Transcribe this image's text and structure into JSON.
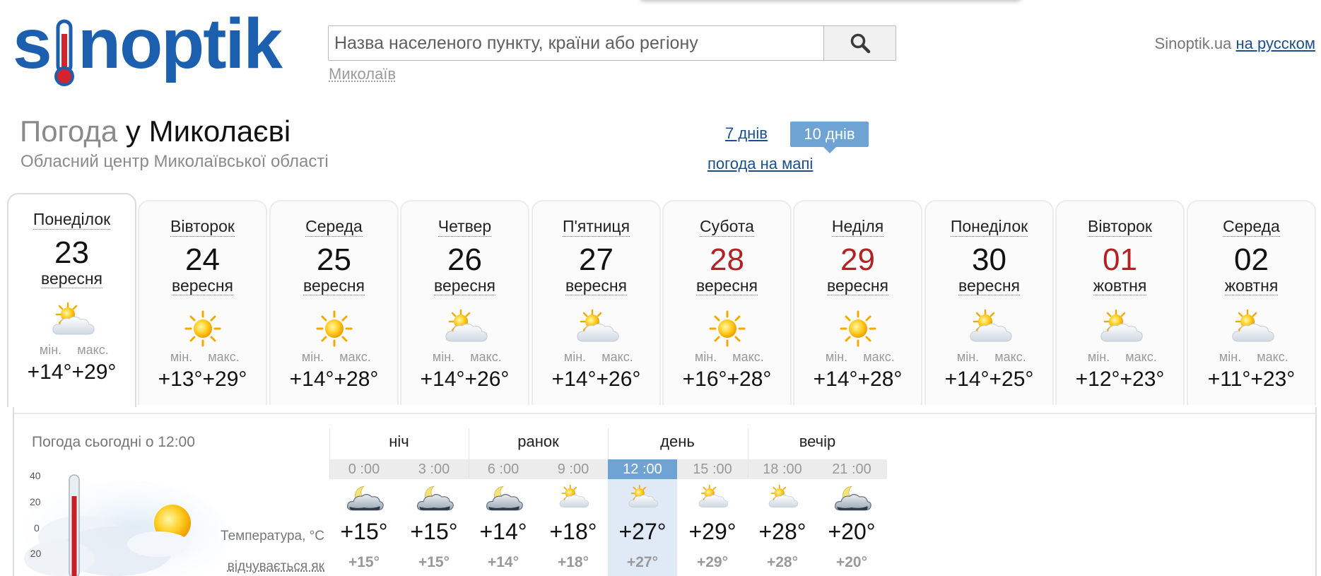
{
  "header": {
    "search_placeholder": "Назва населеного пункту, країни або регіону",
    "recent_city": "Миколаїв",
    "site_name": "Sinoptik.ua",
    "lang_link": "на русском"
  },
  "page": {
    "title_prefix": "Погода",
    "title_city": "у Миколаєві",
    "subtitle": "Обласний центр Миколаївської області",
    "days7": "7 днів",
    "days10": "10 днів",
    "map_link": "погода на мапі"
  },
  "days": [
    {
      "name": "Понеділок",
      "num": "23",
      "month": "вересня",
      "min_label": "мін.",
      "max_label": "макс.",
      "min": "+14°",
      "max": "+29°",
      "icon": "sun-cloud-icon",
      "weekend": false,
      "active": true
    },
    {
      "name": "Вівторок",
      "num": "24",
      "month": "вересня",
      "min_label": "мін.",
      "max_label": "макс.",
      "min": "+13°",
      "max": "+29°",
      "icon": "sun-icon",
      "weekend": false,
      "active": false
    },
    {
      "name": "Середа",
      "num": "25",
      "month": "вересня",
      "min_label": "мін.",
      "max_label": "макс.",
      "min": "+14°",
      "max": "+28°",
      "icon": "sun-icon",
      "weekend": false,
      "active": false
    },
    {
      "name": "Четвер",
      "num": "26",
      "month": "вересня",
      "min_label": "мін.",
      "max_label": "макс.",
      "min": "+14°",
      "max": "+26°",
      "icon": "sun-cloud-icon",
      "weekend": false,
      "active": false
    },
    {
      "name": "П'ятниця",
      "num": "27",
      "month": "вересня",
      "min_label": "мін.",
      "max_label": "макс.",
      "min": "+14°",
      "max": "+26°",
      "icon": "sun-cloud-icon",
      "weekend": false,
      "active": false
    },
    {
      "name": "Субота",
      "num": "28",
      "month": "вересня",
      "min_label": "мін.",
      "max_label": "макс.",
      "min": "+16°",
      "max": "+28°",
      "icon": "sun-icon",
      "weekend": true,
      "active": false
    },
    {
      "name": "Неділя",
      "num": "29",
      "month": "вересня",
      "min_label": "мін.",
      "max_label": "макс.",
      "min": "+14°",
      "max": "+28°",
      "icon": "sun-icon",
      "weekend": true,
      "active": false
    },
    {
      "name": "Понеділок",
      "num": "30",
      "month": "вересня",
      "min_label": "мін.",
      "max_label": "макс.",
      "min": "+14°",
      "max": "+25°",
      "icon": "sun-cloud-icon",
      "weekend": false,
      "active": false
    },
    {
      "name": "Вівторок",
      "num": "01",
      "month": "жовтня",
      "min_label": "мін.",
      "max_label": "макс.",
      "min": "+12°",
      "max": "+23°",
      "icon": "sun-cloud-icon",
      "weekend": true,
      "active": false
    },
    {
      "name": "Середа",
      "num": "02",
      "month": "жовтня",
      "min_label": "мін.",
      "max_label": "макс.",
      "min": "+11°",
      "max": "+23°",
      "icon": "sun-cloud-icon",
      "weekend": false,
      "active": false
    }
  ],
  "detail": {
    "today_label": "Погода сьогодні о 12:00",
    "thermo_scale": [
      "40",
      "20",
      "0",
      "-20"
    ],
    "temp_row_label": "Температура, °C",
    "feels_row_label": "відчувається як",
    "periods": [
      "ніч",
      "ранок",
      "день",
      "вечір"
    ],
    "hours": [
      {
        "time": "0 :00",
        "icon": "moon-cloud-icon",
        "temp": "+15°",
        "feels": "+15°",
        "now": false
      },
      {
        "time": "3 :00",
        "icon": "moon-cloud-icon",
        "temp": "+15°",
        "feels": "+15°",
        "now": false
      },
      {
        "time": "6 :00",
        "icon": "moon-cloud-icon",
        "temp": "+14°",
        "feels": "+14°",
        "now": false
      },
      {
        "time": "9 :00",
        "icon": "sun-cloud-icon",
        "temp": "+18°",
        "feels": "+18°",
        "now": false
      },
      {
        "time": "12 :00",
        "icon": "sun-cloud-icon",
        "temp": "+27°",
        "feels": "+27°",
        "now": true
      },
      {
        "time": "15 :00",
        "icon": "sun-cloud-icon",
        "temp": "+29°",
        "feels": "+29°",
        "now": false
      },
      {
        "time": "18 :00",
        "icon": "sun-cloud-icon",
        "temp": "+28°",
        "feels": "+28°",
        "now": false
      },
      {
        "time": "21 :00",
        "icon": "moon-cloud-icon",
        "temp": "+20°",
        "feels": "+20°",
        "now": false
      }
    ]
  },
  "colors": {
    "brand_blue": "#1c5fae",
    "thermo_red": "#d1242f",
    "weekend_red": "#b22222",
    "accent_tab": "#6ea3d4",
    "now_column": "#dfeaf6"
  }
}
